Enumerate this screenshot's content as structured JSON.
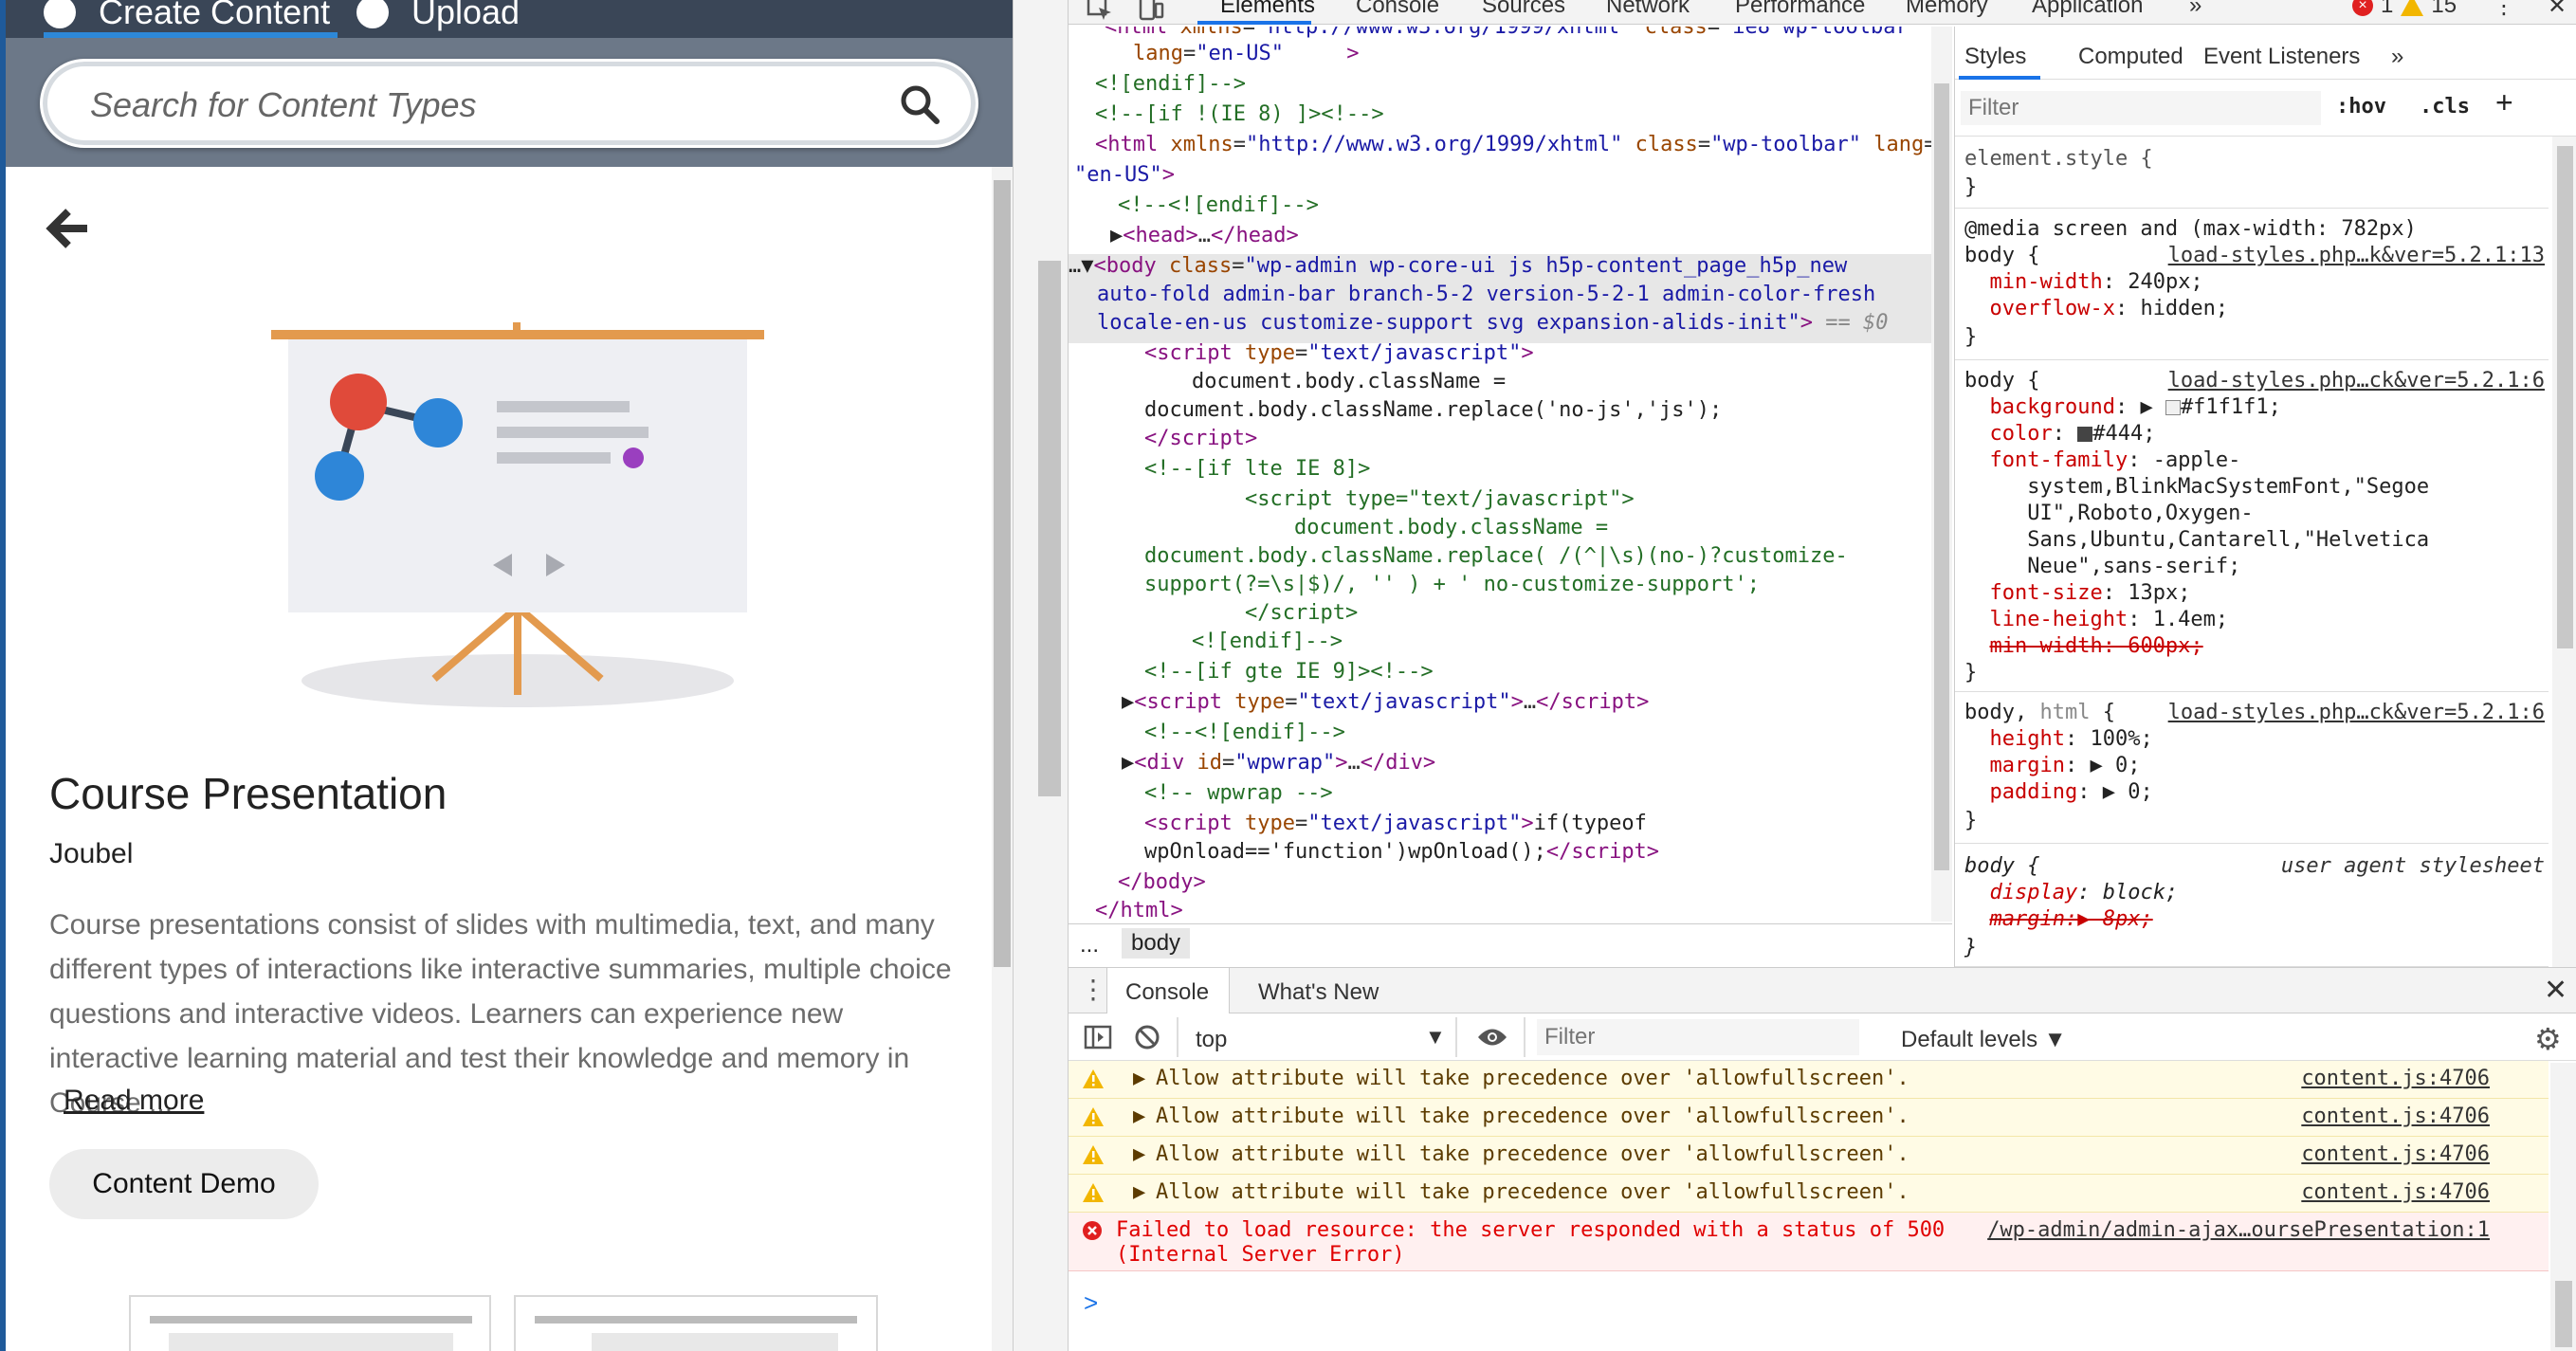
{
  "left": {
    "tabs": [
      {
        "label": "Create Content"
      },
      {
        "label": "Upload"
      }
    ],
    "search": {
      "placeholder": "Search for Content Types"
    },
    "content_type": {
      "title": "Course Presentation",
      "author": "Joubel",
      "description": "Course presentations consist of slides with multimedia, text, and many different types of interactions like interactive summaries, multiple choice questions and interactive videos. Learners can experience new interactive learning material and test their knowledge and memory in Course ...",
      "read_more": "Read more",
      "demo_button": "Content Demo"
    }
  },
  "devtools": {
    "tabs": [
      "Elements",
      "Console",
      "Sources",
      "Network",
      "Performance",
      "Memory",
      "Application"
    ],
    "more_tabs": "»",
    "error_count": "1",
    "warning_count": "15",
    "breadcrumb": {
      "ellipsis": "...",
      "item": "body"
    },
    "styles": {
      "tabs": [
        "Styles",
        "Computed",
        "Event Listeners",
        "»"
      ],
      "filter_placeholder": "Filter",
      "hov": ":hov",
      "cls": ".cls",
      "plus": "+"
    },
    "console": {
      "tabs": [
        "Console",
        "What's New"
      ],
      "context": "top",
      "filter_placeholder": "Filter",
      "levels": "Default levels",
      "messages": [
        {
          "type": "warn",
          "text": "Allow attribute will take precedence over 'allowfullscreen'.",
          "source": "content.js:4706"
        },
        {
          "type": "warn",
          "text": "Allow attribute will take precedence over 'allowfullscreen'.",
          "source": "content.js:4706"
        },
        {
          "type": "warn",
          "text": "Allow attribute will take precedence over 'allowfullscreen'.",
          "source": "content.js:4706"
        },
        {
          "type": "warn",
          "text": "Allow attribute will take precedence over 'allowfullscreen'.",
          "source": "content.js:4706"
        },
        {
          "type": "error",
          "text": "Failed to load resource: the server responded with a status of 500",
          "text2": "(Internal Server Error)",
          "source": "/wp-admin/admin-ajax…oursePresentation:1"
        }
      ],
      "prompt": ">"
    }
  },
  "colors": {
    "accent": "#1a73e8",
    "warning_bg": "#fffbe5",
    "error_text": "#e00000",
    "tag": "#881280",
    "attr": "#994500",
    "val": "#1a1aa6",
    "comment": "#236e25"
  }
}
